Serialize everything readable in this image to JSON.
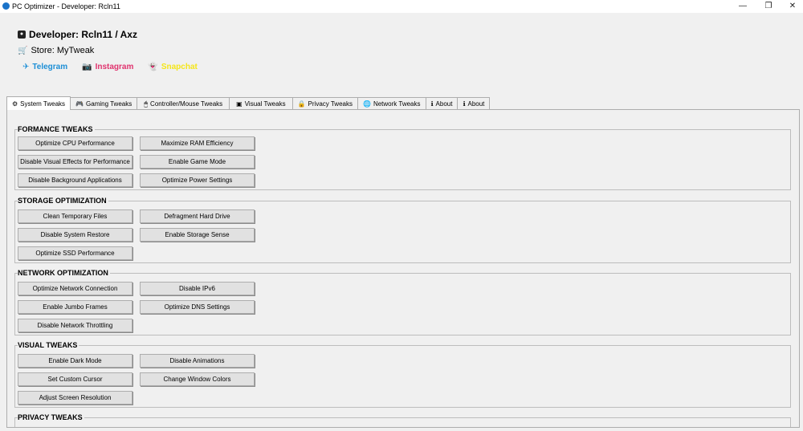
{
  "window": {
    "title": "PC Optimizer - Developer: Rcln11",
    "minimize": "—",
    "maximize": "❐",
    "close": "✕"
  },
  "header": {
    "developer": "Developer: Rcln11 / Axz",
    "store": "Store: MyTweak",
    "links": {
      "telegram": "Telegram",
      "instagram": "Instagram",
      "snapchat": "Snapchat"
    }
  },
  "tabs": [
    {
      "label": "System Tweaks",
      "icon": "gear-icon"
    },
    {
      "label": "Gaming Tweaks",
      "icon": "gamepad-icon"
    },
    {
      "label": "Controller/Mouse Tweaks",
      "icon": "mouse-icon"
    },
    {
      "label": "Visual Tweaks",
      "icon": "monitor-icon"
    },
    {
      "label": "Privacy Tweaks",
      "icon": "lock-icon"
    },
    {
      "label": "Network Tweaks",
      "icon": "globe-icon"
    },
    {
      "label": "About",
      "icon": "info-icon"
    },
    {
      "label": "About",
      "icon": "info-icon"
    }
  ],
  "groups": {
    "performance": {
      "title": "FORMANCE TWEAKS",
      "buttons": [
        "Optimize CPU Performance",
        "Maximize RAM Efficiency",
        "Disable Visual Effects for Performance",
        "Enable Game Mode",
        "Disable Background Applications",
        "Optimize Power Settings"
      ]
    },
    "storage": {
      "title": "STORAGE OPTIMIZATION",
      "buttons": [
        "Clean Temporary Files",
        "Defragment Hard Drive",
        "Disable System Restore",
        "Enable Storage Sense",
        "Optimize SSD Performance"
      ]
    },
    "network": {
      "title": "NETWORK OPTIMIZATION",
      "buttons": [
        "Optimize Network Connection",
        "Disable IPv6",
        "Enable Jumbo Frames",
        "Optimize DNS Settings",
        "Disable Network Throttling"
      ]
    },
    "visual": {
      "title": "VISUAL TWEAKS",
      "buttons": [
        "Enable Dark Mode",
        "Disable Animations",
        "Set Custom Cursor",
        "Change Window Colors",
        "Adjust Screen Resolution"
      ]
    },
    "privacy": {
      "title": "PRIVACY TWEAKS"
    }
  }
}
